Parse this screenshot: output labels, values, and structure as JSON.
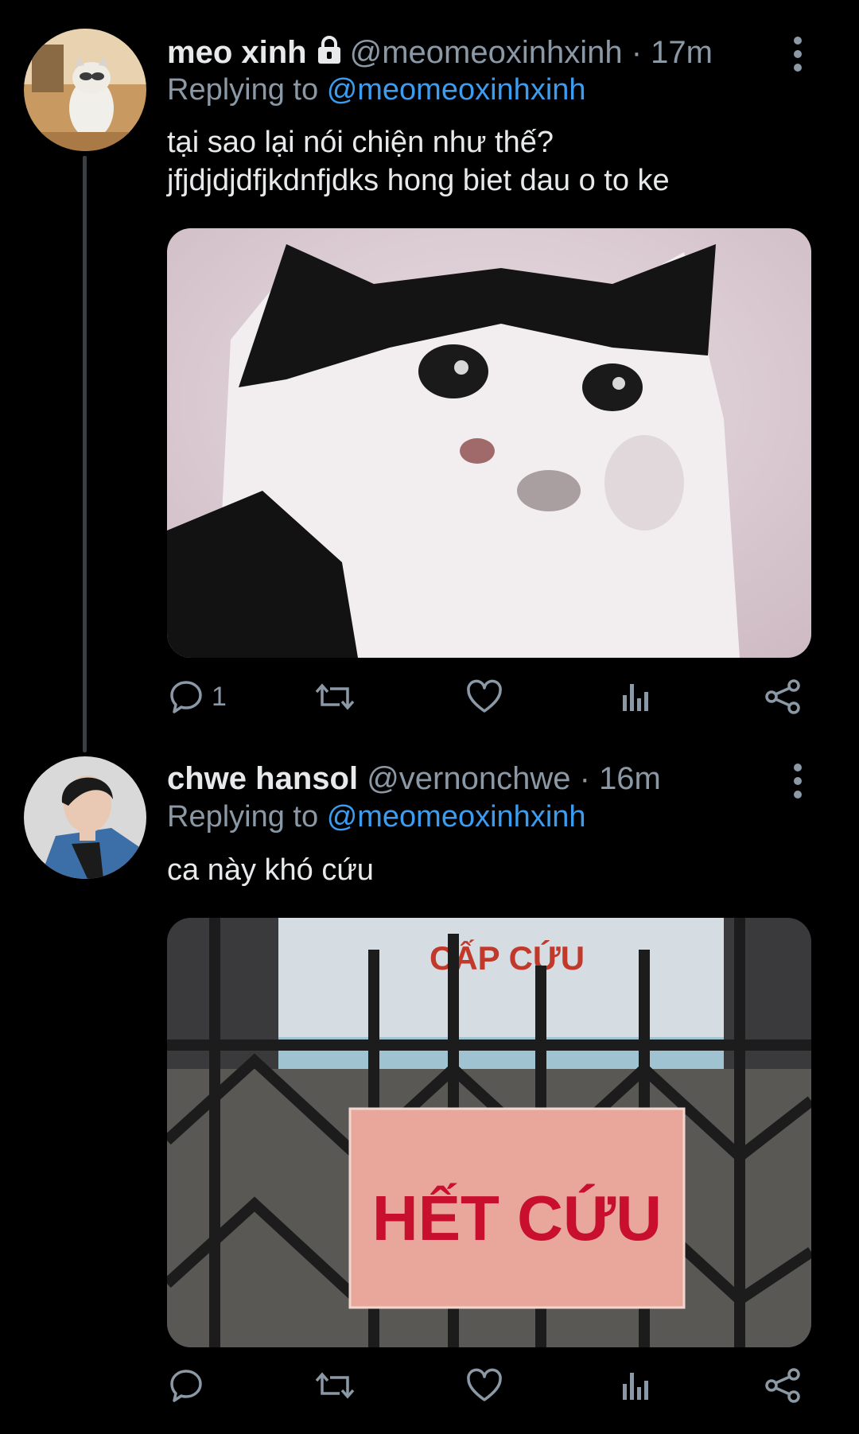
{
  "tweets": [
    {
      "name": "meo xinh",
      "handle": "@meomeoxinhxinh",
      "separator": "·",
      "time": "17m",
      "replying_prefix": "Replying to",
      "replying_to": "@meomeoxinhxinh",
      "text": "tại sao lại nói chiện như thế?\njfjdjdjdfjkdnfjdks hong biet dau o to ke",
      "reply_count": "1",
      "locked": true
    },
    {
      "name": "chwe hansol",
      "handle": "@vernonchwe",
      "separator": "·",
      "time": "16m",
      "replying_prefix": "Replying to",
      "replying_to": "@meomeoxinhxinh",
      "text": "ca này khó cứu",
      "reply_count": "",
      "locked": false,
      "media_sign_text": "HẾT CỨU",
      "media_wall_text": "CẤP CỨU"
    }
  ],
  "icons": [
    "lock-icon",
    "more-icon",
    "reply-icon",
    "retweet-icon",
    "like-icon",
    "analytics-icon",
    "share-icon"
  ],
  "colors": {
    "background": "#000000",
    "text": "#e7e9ea",
    "muted": "#8b98a5",
    "mention": "#3b9cf0"
  }
}
